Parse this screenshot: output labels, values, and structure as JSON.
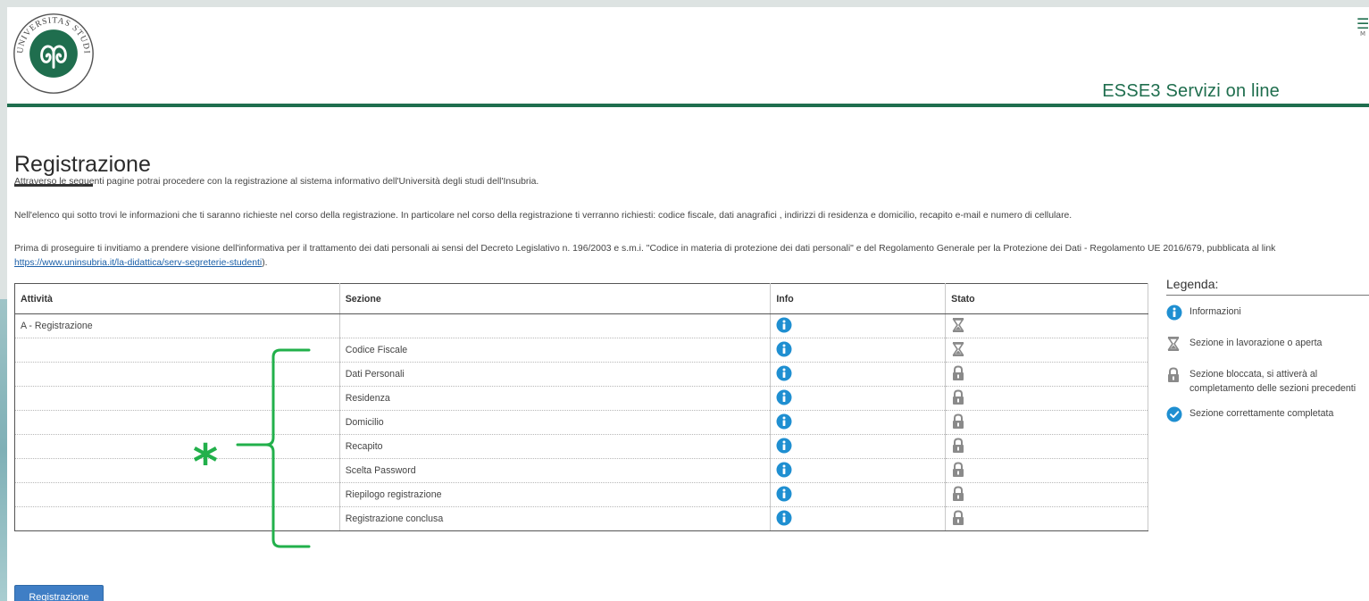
{
  "header": {
    "logo_text": "UNIVERSITAS STUDIORUM INSUBRIAE",
    "menu_label": "M",
    "app_title": "ESSE3 Servizi on line"
  },
  "page": {
    "title": "Registrazione",
    "intro1": "Attraverso le seguenti pagine potrai procedere con la registrazione al sistema informativo dell'Università degli studi dell'Insubria.",
    "intro2": "Nell'elenco qui sotto trovi le informazioni che ti saranno richieste nel corso della registrazione. In particolare nel corso della registrazione ti verranno richiesti: codice fiscale, dati anagrafici , indirizzi di residenza e domicilio, recapito e-mail e numero di cellulare.",
    "intro3_before": "Prima di proseguire ti invitiamo a prendere visione dell'informativa per il trattamento dei dati personali ai sensi del Decreto Legislativo n. 196/2003 e s.m.i. \"Codice in materia di protezione dei dati personali\" e del Regolamento Generale per la Protezione dei Dati - Regolamento UE 2016/679, pubblicata al link ",
    "intro3_link": "https://www.uninsubria.it/la-didattica/serv-segreterie-studenti",
    "intro3_after": ")."
  },
  "table": {
    "headers": [
      "Attività",
      "Sezione",
      "Info",
      "Stato"
    ],
    "rows": [
      {
        "attivita": "A - Registrazione",
        "sezione": "",
        "stato": "hourglass-icon"
      },
      {
        "attivita": "",
        "sezione": "Codice Fiscale",
        "stato": "hourglass-icon"
      },
      {
        "attivita": "",
        "sezione": "Dati Personali",
        "stato": "lock-icon"
      },
      {
        "attivita": "",
        "sezione": "Residenza",
        "stato": "lock-icon"
      },
      {
        "attivita": "",
        "sezione": "Domicilio",
        "stato": "lock-icon"
      },
      {
        "attivita": "",
        "sezione": "Recapito",
        "stato": "lock-icon"
      },
      {
        "attivita": "",
        "sezione": "Scelta Password",
        "stato": "lock-icon"
      },
      {
        "attivita": "",
        "sezione": "Riepilogo registrazione",
        "stato": "lock-icon"
      },
      {
        "attivita": "",
        "sezione": "Registrazione conclusa",
        "stato": "lock-icon"
      }
    ]
  },
  "legend": {
    "title": "Legenda:",
    "items": [
      {
        "icon": "info-icon",
        "text": "Informazioni"
      },
      {
        "icon": "hourglass-icon",
        "text": "Sezione in lavorazione o aperta"
      },
      {
        "icon": "lock-icon",
        "text": "Sezione bloccata, si attiverà al completamento delle sezioni precedenti"
      },
      {
        "icon": "check-icon",
        "text": "Sezione correttamente completata"
      }
    ]
  },
  "button": {
    "label": "Registrazione"
  },
  "annotation": {
    "symbol": "*"
  },
  "colors": {
    "brand_green": "#1f6e4e",
    "info_blue": "#1f8fd1",
    "button_blue": "#3f7ec5",
    "annotation_green": "#22b04b",
    "status_gray": "#8a8a8a"
  }
}
